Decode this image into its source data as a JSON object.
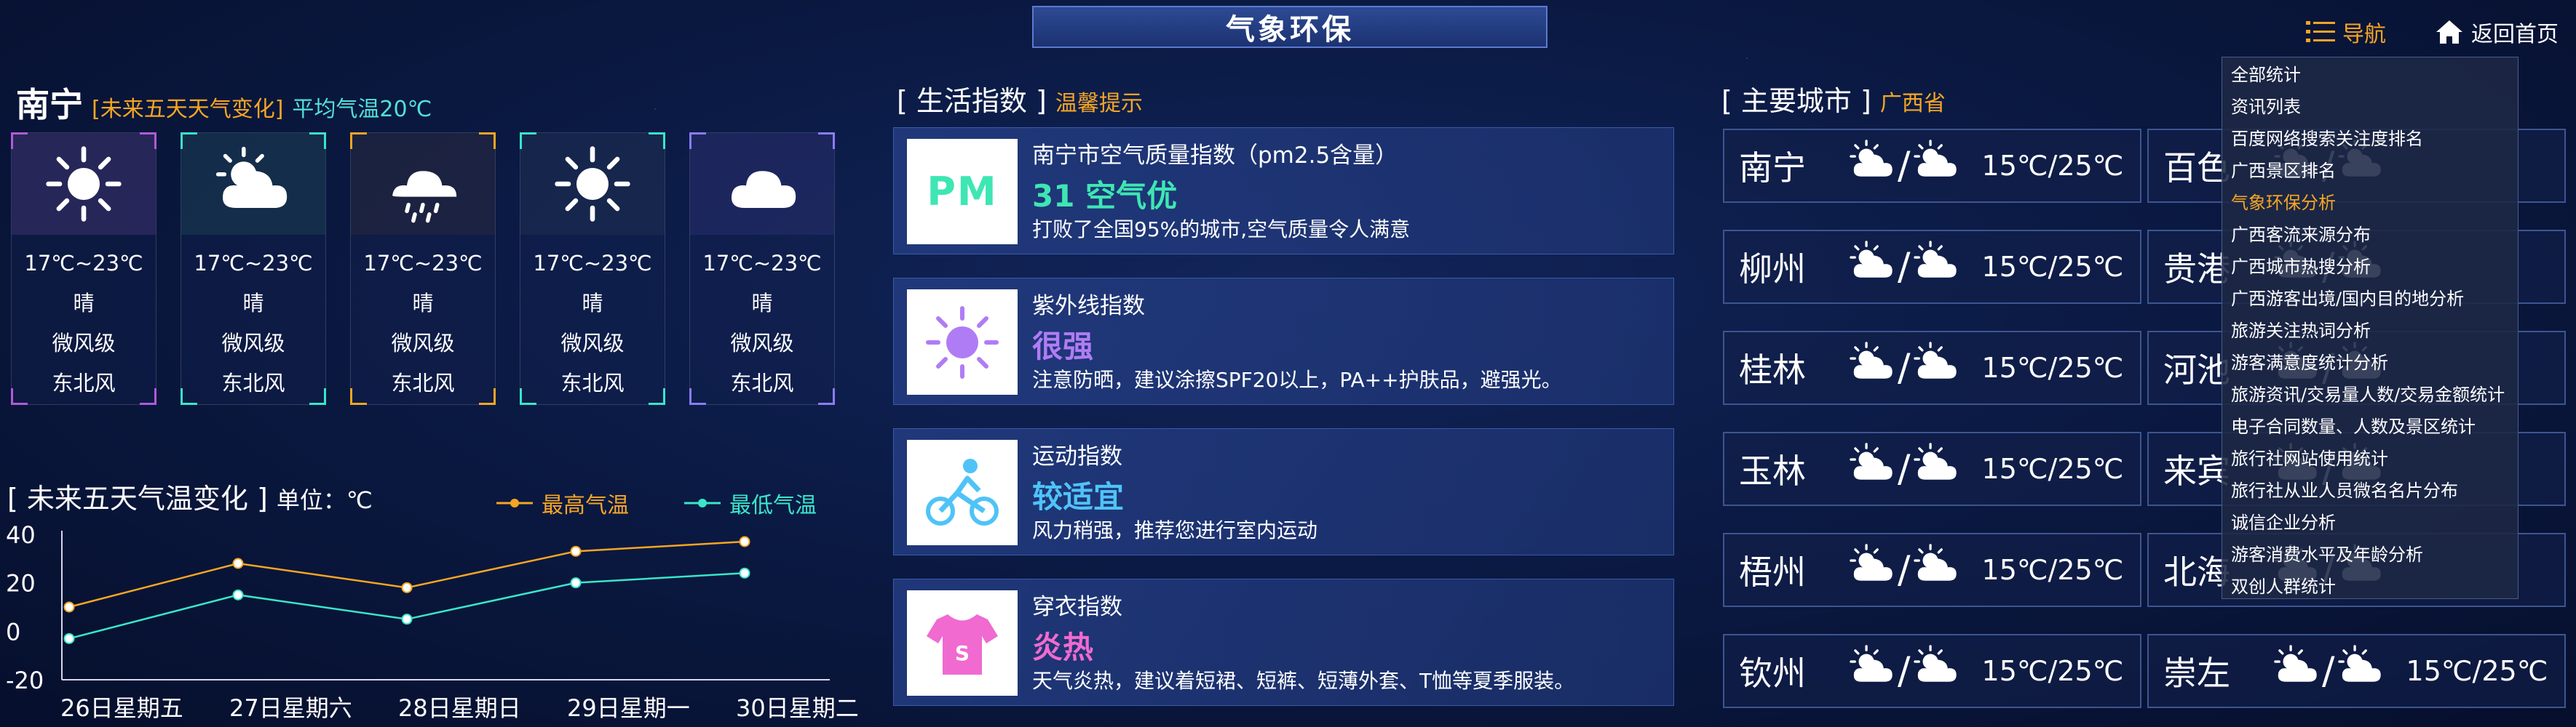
{
  "header": {
    "title": "气象环保",
    "nav_label": "导航",
    "home_label": "返回首页"
  },
  "weather": {
    "city": "南宁",
    "subtitle": "[未来五天天气变化]",
    "avg_temp": "平均气温20℃",
    "days": [
      {
        "temp": "17℃~23℃",
        "cond": "晴",
        "wind_level": "微风级",
        "wind_dir": "东北风",
        "icon": "sun-icon"
      },
      {
        "temp": "17℃~23℃",
        "cond": "晴",
        "wind_level": "微风级",
        "wind_dir": "东北风",
        "icon": "partly-cloudy-icon"
      },
      {
        "temp": "17℃~23℃",
        "cond": "晴",
        "wind_level": "微风级",
        "wind_dir": "东北风",
        "icon": "rain-cloud-icon"
      },
      {
        "temp": "17℃~23℃",
        "cond": "晴",
        "wind_level": "微风级",
        "wind_dir": "东北风",
        "icon": "sun-icon"
      },
      {
        "temp": "17℃~23℃",
        "cond": "晴",
        "wind_level": "微风级",
        "wind_dir": "东北风",
        "icon": "cloud-icon"
      }
    ]
  },
  "chart_title": {
    "bracket_title": "未来五天气温变化",
    "unit": "单位：℃"
  },
  "chart_data": {
    "type": "line",
    "categories": [
      "26日星期五",
      "27日星期六",
      "28日星期日",
      "29日星期一",
      "30日星期二"
    ],
    "series": [
      {
        "name": "最高气温",
        "color": "#f5a623",
        "values": [
          10,
          28,
          18,
          33,
          37
        ]
      },
      {
        "name": "最低气温",
        "color": "#39e6c8",
        "values": [
          -3,
          15,
          5,
          20,
          24
        ]
      }
    ],
    "yticks": [
      "40",
      "20",
      "0",
      "-20"
    ],
    "ylim": [
      -20,
      40
    ]
  },
  "life": {
    "title": "生活指数",
    "subtitle": "温馨提示",
    "cards": [
      {
        "name": "南宁市空气质量指数（pm2.5含量）",
        "level": "31 空气优",
        "desc": "打败了全国95%的城市,空气质量令人满意",
        "color": "#3ee6b3",
        "icon": "pm-icon",
        "icon_text": "PM"
      },
      {
        "name": "紫外线指数",
        "level": "很强",
        "desc": "注意防晒，建议涂擦SPF20以上，PA++护肤品，避强光。",
        "color": "#b07cf5",
        "icon": "uv-sun-icon"
      },
      {
        "name": "运动指数",
        "level": "较适宜",
        "desc": "风力稍强，推荐您进行室内运动",
        "color": "#4fc3f7",
        "icon": "cycling-icon"
      },
      {
        "name": "穿衣指数",
        "level": "炎热",
        "desc": "天气炎热，建议着短裙、短裤、短薄外套、T恤等夏季服装。",
        "color": "#f06ad0",
        "icon": "tshirt-icon",
        "icon_text": "S"
      }
    ]
  },
  "cities": {
    "title": "主要城市",
    "subtitle": "广西省",
    "left": [
      {
        "name": "南宁",
        "temp": "15℃/25℃"
      },
      {
        "name": "柳州",
        "temp": "15℃/25℃"
      },
      {
        "name": "桂林",
        "temp": "15℃/25℃"
      },
      {
        "name": "玉林",
        "temp": "15℃/25℃"
      },
      {
        "name": "梧州",
        "temp": "15℃/25℃"
      },
      {
        "name": "钦州",
        "temp": "15℃/25℃"
      }
    ],
    "right": [
      {
        "name": "百色",
        "temp": ""
      },
      {
        "name": "贵港",
        "temp": ""
      },
      {
        "name": "河池",
        "temp": ""
      },
      {
        "name": "来宾",
        "temp": ""
      },
      {
        "name": "北海",
        "temp": ""
      },
      {
        "name": "崇左",
        "temp": "15℃/25℃"
      }
    ]
  },
  "dropdown": {
    "items": [
      "全部统计",
      "资讯列表",
      "百度网络搜索关注度排名",
      "广西景区排名",
      "气象环保分析",
      "广西客流来源分布",
      "广西城市热搜分析",
      "广西游客出境/国内目的地分析",
      "旅游关注热词分析",
      "游客满意度统计分析",
      "旅游资讯/交易量人数/交易金额统计",
      "电子合同数量、人数及景区统计",
      "旅行社网站使用统计",
      "旅行社从业人员微名名片分布",
      "诚信企业分析",
      "游客消费水平及年龄分析",
      "双创人群统计"
    ],
    "active_index": 4
  },
  "colors": {
    "accent": "#f5a623",
    "teal": "#39e6c8",
    "panel": "#1e3473"
  }
}
